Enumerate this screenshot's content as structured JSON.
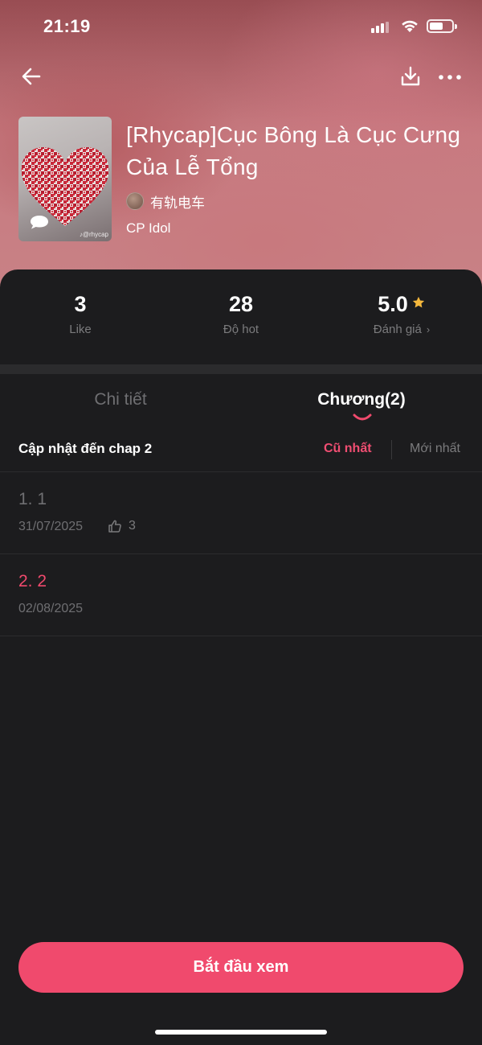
{
  "status_bar": {
    "time": "21:19",
    "battery_level": 0.55
  },
  "book": {
    "title": "[Rhycap]Cục Bông Là Cục Cưng Của Lễ Tổng",
    "author": "有轨电车",
    "tag": "CP Idol",
    "cover_watermark": "♪@rhycap"
  },
  "stats": {
    "like_value": "3",
    "like_label": "Like",
    "hot_value": "28",
    "hot_label": "Độ hot",
    "rating_value": "5.0",
    "rating_label": "Đánh giá",
    "star_color": "#f5b83d"
  },
  "tabs": {
    "detail": "Chi tiết",
    "chapter": "Chương(2)",
    "active": "chapter"
  },
  "sort": {
    "title": "Cập nhật đến chap 2",
    "oldest": "Cũ nhất",
    "newest": "Mới nhất",
    "active": "oldest"
  },
  "chapters": [
    {
      "name": "1. 1",
      "date": "31/07/2025",
      "likes": "3",
      "state": "read"
    },
    {
      "name": "2. 2",
      "date": "02/08/2025",
      "state": "current"
    }
  ],
  "cta": {
    "label": "Bắt đầu xem"
  },
  "colors": {
    "accent": "#f04a6d",
    "background": "#1c1c1e",
    "muted": "#7b7b7d"
  },
  "icons": {
    "back": "arrow-left-icon",
    "download": "download-icon",
    "more": "more-dots-icon",
    "thumbs_up": "thumbs-up-icon",
    "star": "star-icon"
  }
}
